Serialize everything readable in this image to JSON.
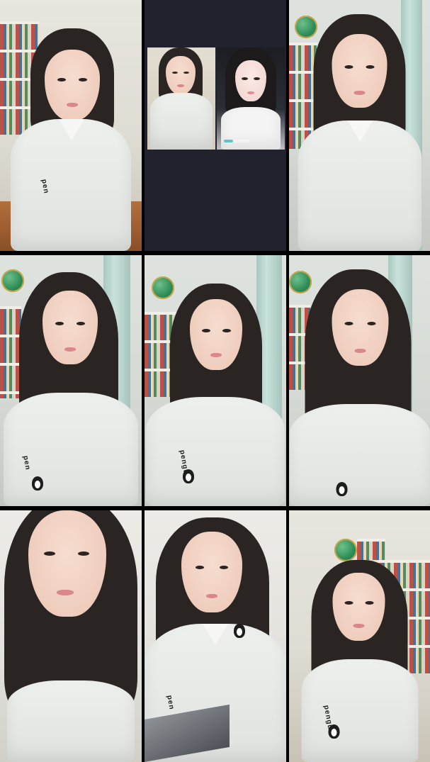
{
  "screen": {
    "name": "multi-guest video call grid",
    "grid": {
      "columns": 3,
      "rows": 3
    }
  },
  "tiles": [
    {
      "id": "guest-1",
      "badge_text": "pen"
    },
    {
      "id": "guest-2-split",
      "split": true,
      "progress_fraction": 0.35
    },
    {
      "id": "guest-3",
      "badge_text": ""
    },
    {
      "id": "guest-4",
      "badge_text": "pen"
    },
    {
      "id": "guest-5",
      "badge_text": "pengui"
    },
    {
      "id": "guest-6",
      "badge_text": ""
    },
    {
      "id": "guest-7",
      "badge_text": ""
    },
    {
      "id": "guest-8",
      "badge_text": "pen"
    },
    {
      "id": "guest-9",
      "badge_text": "pengui"
    }
  ],
  "colors": {
    "background": "#000000",
    "split_tile_bg": "#22222e",
    "progress_accent": "#5fc2c7",
    "shirt": "#eef0ee",
    "hair": "#2a2522"
  },
  "icons": [
    "penguin-logo-icon"
  ]
}
